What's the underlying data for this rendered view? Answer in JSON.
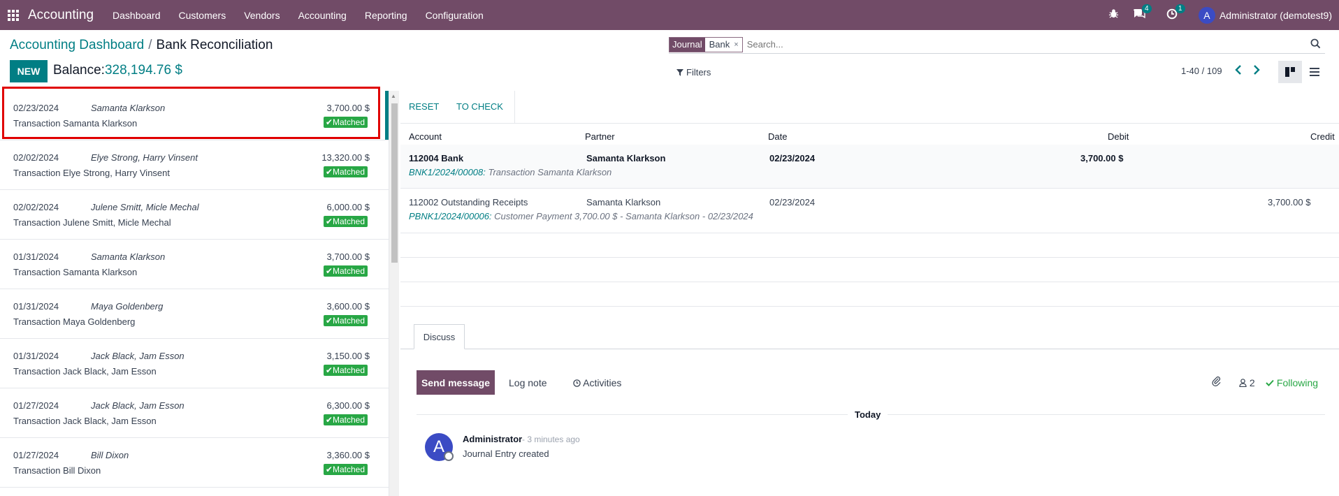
{
  "topbar": {
    "app_name": "Accounting",
    "menu": [
      "Dashboard",
      "Customers",
      "Vendors",
      "Accounting",
      "Reporting",
      "Configuration"
    ],
    "messages_count": "4",
    "activities_count": "1",
    "user_initial": "A",
    "user_name": "Administrator (demotest9)"
  },
  "breadcrumb": {
    "parent": "Accounting Dashboard",
    "separator": "/",
    "current": "Bank Reconciliation"
  },
  "actions": {
    "new_label": "NEW",
    "balance_label": "Balance:",
    "balance_value": "328,194.76 $"
  },
  "search": {
    "facet_key": "Journal",
    "facet_value": "Bank",
    "facet_remove": "×",
    "placeholder": "Search..."
  },
  "filters_label": "Filters",
  "pager": {
    "text": "1-40 / 109"
  },
  "transactions": [
    {
      "date": "02/23/2024",
      "partner": "Samanta Klarkson",
      "amount": "3,700.00 $",
      "desc": "Transaction Samanta Klarkson",
      "status": "Matched"
    },
    {
      "date": "02/02/2024",
      "partner": "Elye Strong, Harry Vinsent",
      "amount": "13,320.00 $",
      "desc": "Transaction Elye Strong, Harry Vinsent",
      "status": "Matched"
    },
    {
      "date": "02/02/2024",
      "partner": "Julene Smitt, Micle Mechal",
      "amount": "6,000.00 $",
      "desc": "Transaction Julene Smitt, Micle Mechal",
      "status": "Matched"
    },
    {
      "date": "01/31/2024",
      "partner": "Samanta Klarkson",
      "amount": "3,700.00 $",
      "desc": "Transaction Samanta Klarkson",
      "status": "Matched"
    },
    {
      "date": "01/31/2024",
      "partner": "Maya Goldenberg",
      "amount": "3,600.00 $",
      "desc": "Transaction Maya Goldenberg",
      "status": "Matched"
    },
    {
      "date": "01/31/2024",
      "partner": "Jack Black, Jam Esson",
      "amount": "3,150.00 $",
      "desc": "Transaction Jack Black, Jam Esson",
      "status": "Matched"
    },
    {
      "date": "01/27/2024",
      "partner": "Jack Black, Jam Esson",
      "amount": "6,300.00 $",
      "desc": "Transaction Jack Black, Jam Esson",
      "status": "Matched"
    },
    {
      "date": "01/27/2024",
      "partner": "Bill Dixon",
      "amount": "3,360.00 $",
      "desc": "Transaction Bill Dixon",
      "status": "Matched"
    }
  ],
  "detail": {
    "reset_label": "RESET",
    "to_check_label": "TO CHECK",
    "columns": {
      "account": "Account",
      "partner": "Partner",
      "date": "Date",
      "debit": "Debit",
      "credit": "Credit"
    },
    "lines": [
      {
        "account": "112004 Bank",
        "partner": "Samanta Klarkson",
        "date": "02/23/2024",
        "debit": "3,700.00 $",
        "credit": "",
        "ref": "BNK1/2024/00008:",
        "label": "Transaction Samanta Klarkson"
      },
      {
        "account": "112002 Outstanding Receipts",
        "partner": "Samanta Klarkson",
        "date": "02/23/2024",
        "debit": "",
        "credit": "3,700.00 $",
        "ref": "PBNK1/2024/00006:",
        "label": "Customer Payment 3,700.00 $ - Samanta Klarkson - 02/23/2024"
      }
    ]
  },
  "chatter": {
    "tab_label": "Discuss",
    "send_message": "Send message",
    "log_note": "Log note",
    "activities": "Activities",
    "followers_count": "2",
    "following": "Following",
    "today": "Today",
    "message": {
      "author": "Administrator",
      "time": "- 3 minutes ago",
      "body": "Journal Entry created",
      "initial": "A"
    }
  }
}
